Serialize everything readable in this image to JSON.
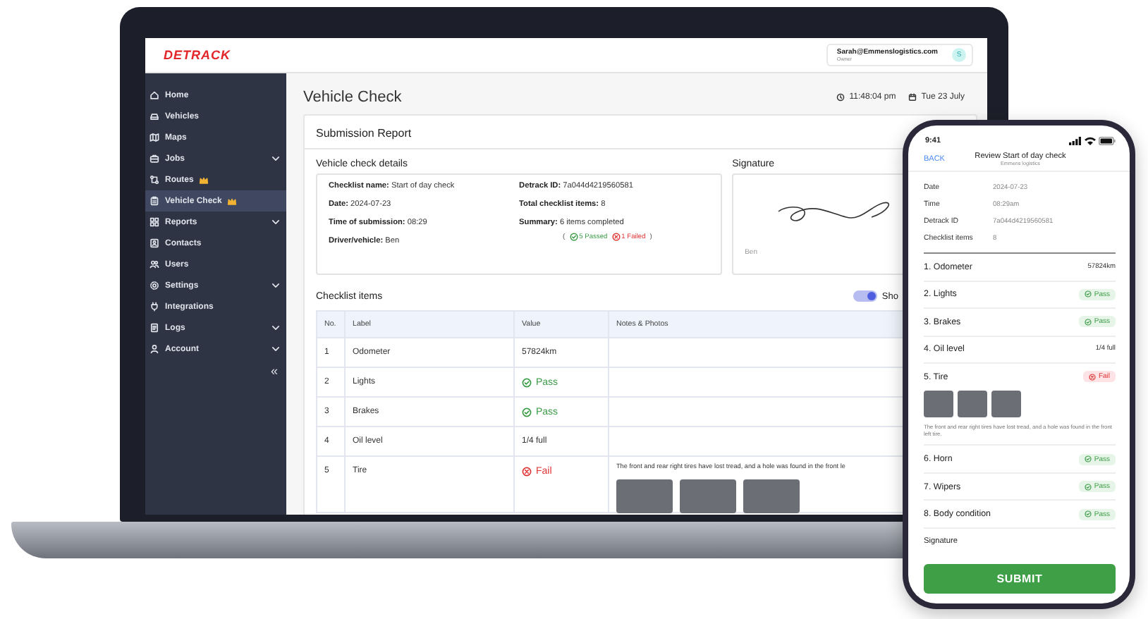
{
  "laptop": {
    "logo": "DETRACK",
    "user": {
      "email": "Sarah@Emmenslogistics.com",
      "role": "Owner",
      "avatar": "S"
    },
    "sidebar": [
      {
        "label": "Home",
        "expandable": false,
        "premium": false,
        "selected": false
      },
      {
        "label": "Vehicles",
        "expandable": false,
        "premium": false,
        "selected": false
      },
      {
        "label": "Maps",
        "expandable": false,
        "premium": false,
        "selected": false
      },
      {
        "label": "Jobs",
        "expandable": true,
        "premium": false,
        "selected": false
      },
      {
        "label": "Routes",
        "expandable": false,
        "premium": true,
        "selected": false
      },
      {
        "label": "Vehicle Check",
        "expandable": false,
        "premium": true,
        "selected": true
      },
      {
        "label": "Reports",
        "expandable": true,
        "premium": false,
        "selected": false
      },
      {
        "label": "Contacts",
        "expandable": false,
        "premium": false,
        "selected": false
      },
      {
        "label": "Users",
        "expandable": false,
        "premium": false,
        "selected": false
      },
      {
        "label": "Settings",
        "expandable": true,
        "premium": false,
        "selected": false
      },
      {
        "label": "Integrations",
        "expandable": false,
        "premium": false,
        "selected": false
      },
      {
        "label": "Logs",
        "expandable": true,
        "premium": false,
        "selected": false
      },
      {
        "label": "Account",
        "expandable": true,
        "premium": false,
        "selected": false
      }
    ],
    "collapse": "«",
    "page_title": "Vehicle Check",
    "time": "11:48:04 pm",
    "date": "Tue 23 July",
    "report": {
      "title": "Submission Report",
      "details_heading": "Vehicle check details",
      "details_left": [
        {
          "label": "Checklist name:",
          "value": "Start of day check"
        },
        {
          "label": "Date:",
          "value": "2024-07-23"
        },
        {
          "label": "Time of submission:",
          "value": "08:29"
        },
        {
          "label": "Driver/vehicle:",
          "value": "Ben"
        }
      ],
      "details_right": [
        {
          "label": "Detrack ID:",
          "value": "7a044d4219560581"
        },
        {
          "label": "Total checklist items:",
          "value": "8"
        },
        {
          "label": "Summary:",
          "value": "6 items completed"
        }
      ],
      "summary_open": "(",
      "passed": "5 Passed",
      "failed": "1 Failed",
      "summary_close": ")",
      "signature_heading": "Signature",
      "signer": "Ben"
    },
    "checklist_heading": "Checklist items",
    "toggle": {
      "on": true,
      "label": "Sho"
    },
    "table": {
      "columns": [
        "No.",
        "Label",
        "Value",
        "Notes & Photos"
      ],
      "rows": [
        {
          "no": "1",
          "label": "Odometer",
          "kind": "text",
          "value": "57824km"
        },
        {
          "no": "2",
          "label": "Lights",
          "kind": "pass",
          "value": "Pass"
        },
        {
          "no": "3",
          "label": "Brakes",
          "kind": "pass",
          "value": "Pass"
        },
        {
          "no": "4",
          "label": "Oil level",
          "kind": "text",
          "value": "1/4 full"
        },
        {
          "no": "5",
          "label": "Tire",
          "kind": "fail",
          "value": "Fail",
          "notes": "The front and rear right tires have lost tread, and a hole was found in the front le",
          "has_photos": true
        }
      ]
    }
  },
  "phone": {
    "time": "9:41",
    "back": "BACK",
    "title": "Review Start of day check",
    "subtitle": "Emmens logistics",
    "details": [
      {
        "label": "Date",
        "value": "2024-07-23"
      },
      {
        "label": "Time",
        "value": "08:29am"
      },
      {
        "label": "Detrack ID",
        "value": "7a044d4219560581"
      },
      {
        "label": "Checklist items",
        "value": "8"
      }
    ],
    "items": [
      {
        "label": "1. Odometer",
        "kind": "text",
        "value": "57824km"
      },
      {
        "label": "2. Lights",
        "kind": "pass",
        "value": "Pass"
      },
      {
        "label": "3. Brakes",
        "kind": "pass",
        "value": "Pass"
      },
      {
        "label": "4. Oil level",
        "kind": "text",
        "value": "1/4 full"
      },
      {
        "label": "5. Tire",
        "kind": "fail",
        "value": "Fail",
        "has_photos": true,
        "notes": "The front and rear right tires have lost tread, and a hole was found in the front left tire."
      },
      {
        "label": "6. Horn",
        "kind": "pass",
        "value": "Pass"
      },
      {
        "label": "7. Wipers",
        "kind": "pass",
        "value": "Pass"
      },
      {
        "label": "8. Body condition",
        "kind": "pass",
        "value": "Pass"
      }
    ],
    "signature": "Signature",
    "submit": "SUBMIT"
  }
}
